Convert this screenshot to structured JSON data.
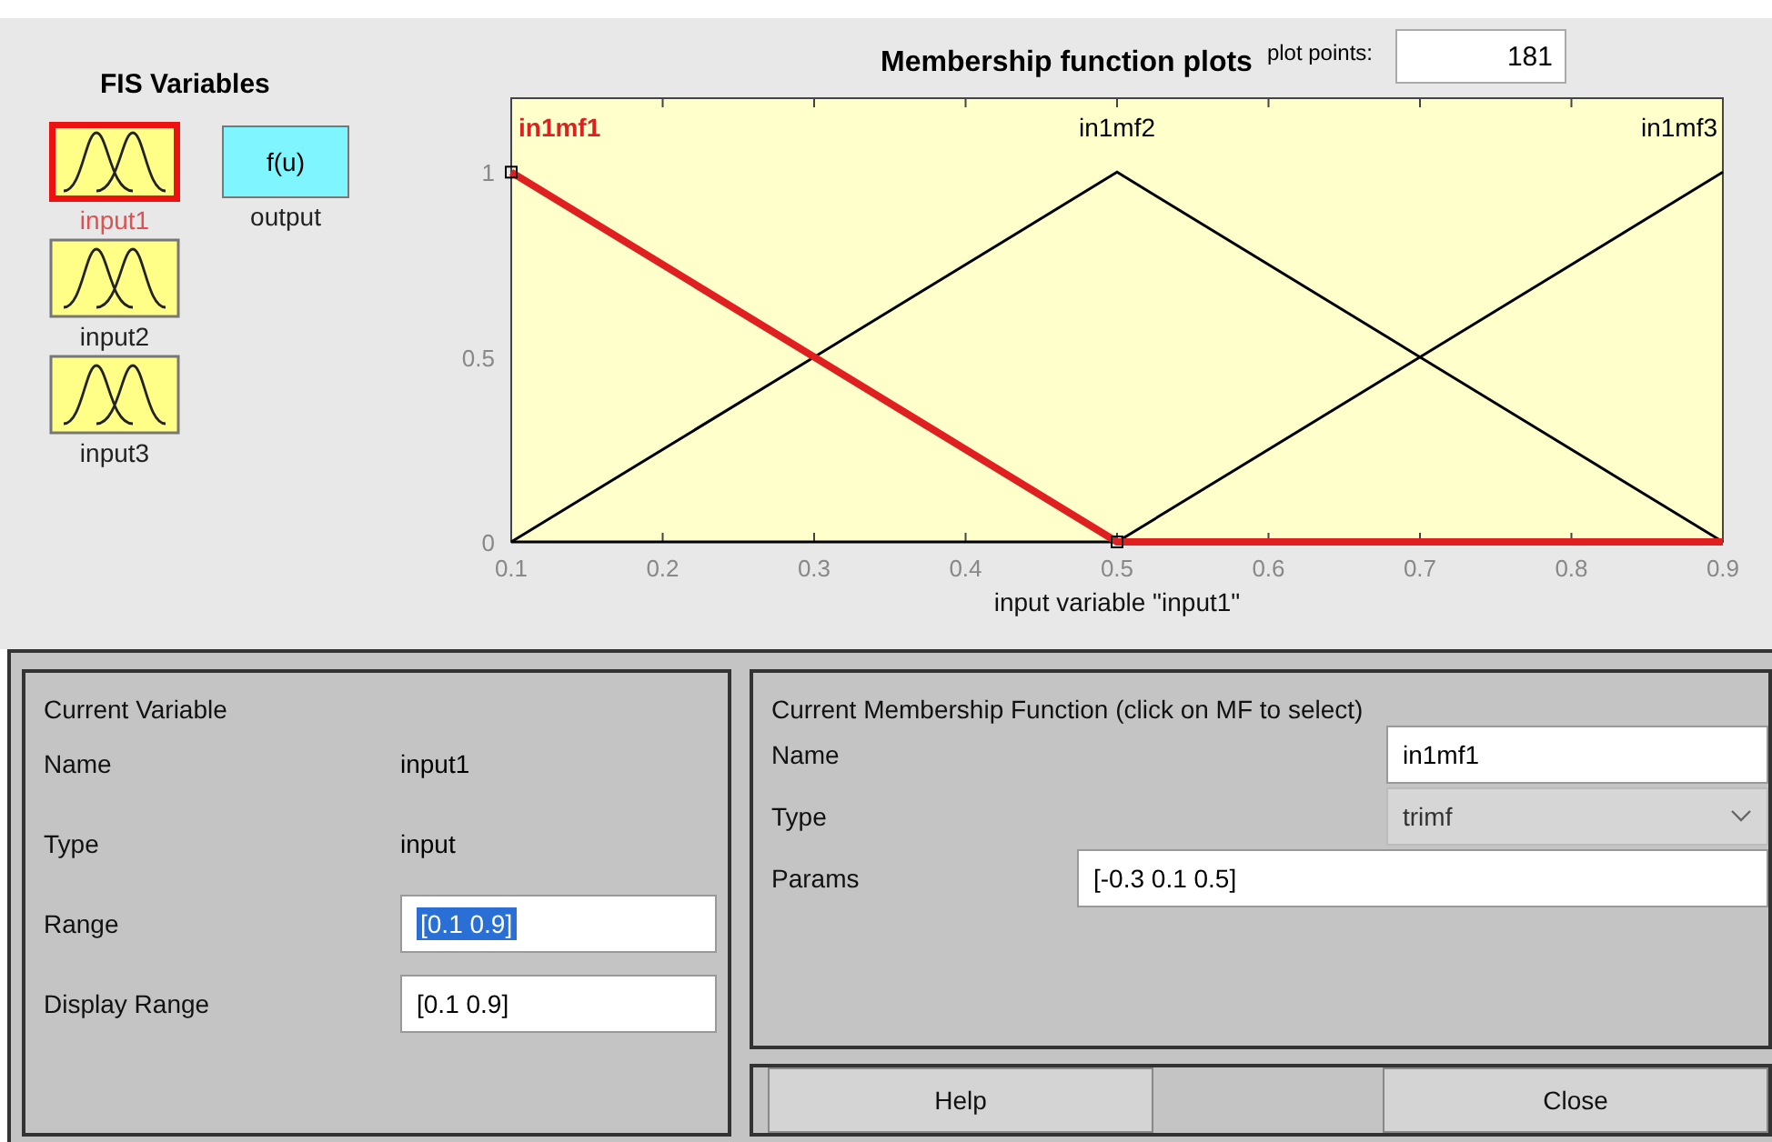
{
  "fis_variables": {
    "title": "FIS Variables",
    "items": [
      {
        "name": "input1",
        "kind": "input",
        "selected": true
      },
      {
        "name": "output",
        "kind": "output",
        "selected": false,
        "icon_text": "f(u)"
      },
      {
        "name": "input2",
        "kind": "input",
        "selected": false
      },
      {
        "name": "input3",
        "kind": "input",
        "selected": false
      }
    ]
  },
  "plot": {
    "title": "Membership function plots",
    "plot_points_label": "plot points:",
    "plot_points": "181",
    "chart_data": {
      "type": "line",
      "xlabel": "input variable \"input1\"",
      "x": [
        0.1,
        0.3,
        0.5,
        0.7,
        0.9
      ],
      "xlim": [
        0.1,
        0.9
      ],
      "ylim": [
        0,
        1.2
      ],
      "xticks": [
        0.1,
        0.2,
        0.3,
        0.4,
        0.5,
        0.6,
        0.7,
        0.8,
        0.9
      ],
      "yticks": [
        0,
        0.5,
        1
      ],
      "series": [
        {
          "name": "in1mf1",
          "color": "#e02020",
          "values": [
            1,
            0.5,
            0,
            0,
            0
          ]
        },
        {
          "name": "in1mf2",
          "color": "#000000",
          "values": [
            0,
            0.5,
            1,
            0.5,
            0
          ]
        },
        {
          "name": "in1mf3",
          "color": "#000000",
          "values": [
            0,
            0,
            0,
            0.5,
            1
          ]
        }
      ]
    },
    "mf_states": [
      {
        "selected": true
      },
      {
        "selected": false
      },
      {
        "selected": false
      }
    ]
  },
  "current_variable": {
    "title": "Current Variable",
    "rows": [
      {
        "label": "Name",
        "kind": "text",
        "value": "input1"
      },
      {
        "label": "Type",
        "kind": "text",
        "value": "input"
      },
      {
        "label": "Range",
        "kind": "field",
        "value": "[0.1 0.9]",
        "highlighted": true
      },
      {
        "label": "Display Range",
        "kind": "field",
        "value": "[0.1 0.9]",
        "highlighted": false
      }
    ]
  },
  "current_mf": {
    "title": "Current Membership Function (click on MF to select)",
    "rows": [
      {
        "label": "Name",
        "kind": "field",
        "value": "in1mf1"
      },
      {
        "label": "Type",
        "kind": "dropdown",
        "value": "trimf"
      },
      {
        "label": "Params",
        "kind": "wide_field",
        "value": "[-0.3 0.1 0.5]"
      }
    ]
  },
  "buttons": [
    "Help",
    "Close"
  ]
}
